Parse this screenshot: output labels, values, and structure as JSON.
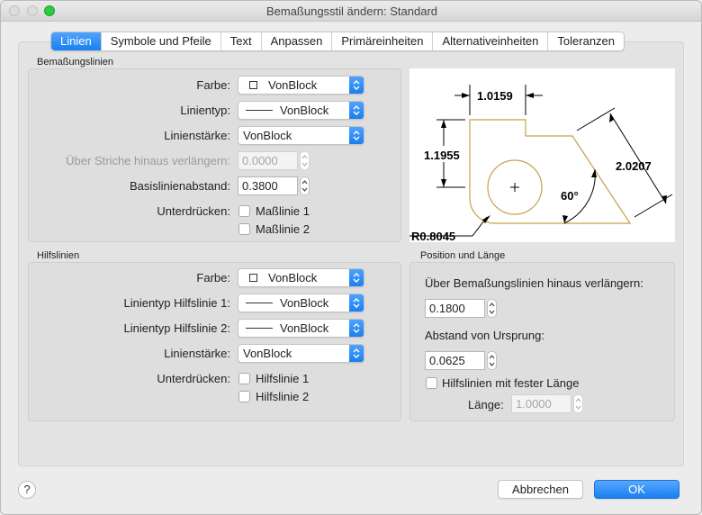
{
  "window": {
    "title": "Bemaßungsstil ändern: Standard"
  },
  "tabs": [
    {
      "label": "Linien",
      "active": true
    },
    {
      "label": "Symbole und Pfeile"
    },
    {
      "label": "Text"
    },
    {
      "label": "Anpassen"
    },
    {
      "label": "Primäreinheiten"
    },
    {
      "label": "Alternativeinheiten"
    },
    {
      "label": "Toleranzen"
    }
  ],
  "dim_lines": {
    "section_label": "Bemaßungslinien",
    "color_label": "Farbe:",
    "color_value": "VonBlock",
    "linetype_label": "Linientyp:",
    "linetype_value": "VonBlock",
    "lineweight_label": "Linienstärke:",
    "lineweight_value": "VonBlock",
    "extend_label": "Über Striche hinaus verlängern:",
    "extend_value": "0.0000",
    "baseline_label": "Basislinienabstand:",
    "baseline_value": "0.3800",
    "suppress_label": "Unterdrücken:",
    "suppress_1": "Maßlinie 1",
    "suppress_2": "Maßlinie 2"
  },
  "ext_lines": {
    "section_label": "Hilfslinien",
    "color_label": "Farbe:",
    "color_value": "VonBlock",
    "linetype1_label": "Linientyp Hilfslinie 1:",
    "linetype1_value": "VonBlock",
    "linetype2_label": "Linientyp Hilfslinie 2:",
    "linetype2_value": "VonBlock",
    "lineweight_label": "Linienstärke:",
    "lineweight_value": "VonBlock",
    "suppress_label": "Unterdrücken:",
    "suppress_1": "Hilfslinie 1",
    "suppress_2": "Hilfslinie 2"
  },
  "position": {
    "section_label": "Position und Länge",
    "extend_label": "Über Bemaßungslinien hinaus verlängern:",
    "extend_value": "0.1800",
    "offset_label": "Abstand von Ursprung:",
    "offset_value": "0.0625",
    "fixed_label": "Hilfslinien mit fester Länge",
    "length_label": "Länge:",
    "length_value": "1.0000"
  },
  "preview": {
    "dim_top": "1.0159",
    "dim_left": "1.1955",
    "dim_right": "2.0207",
    "angle": "60°",
    "radius": "R0.8045",
    "shape_color": "#c8a04a"
  },
  "buttons": {
    "help": "?",
    "cancel": "Abbrechen",
    "ok": "OK"
  },
  "colors": {
    "accent": "#1a7ff0"
  }
}
